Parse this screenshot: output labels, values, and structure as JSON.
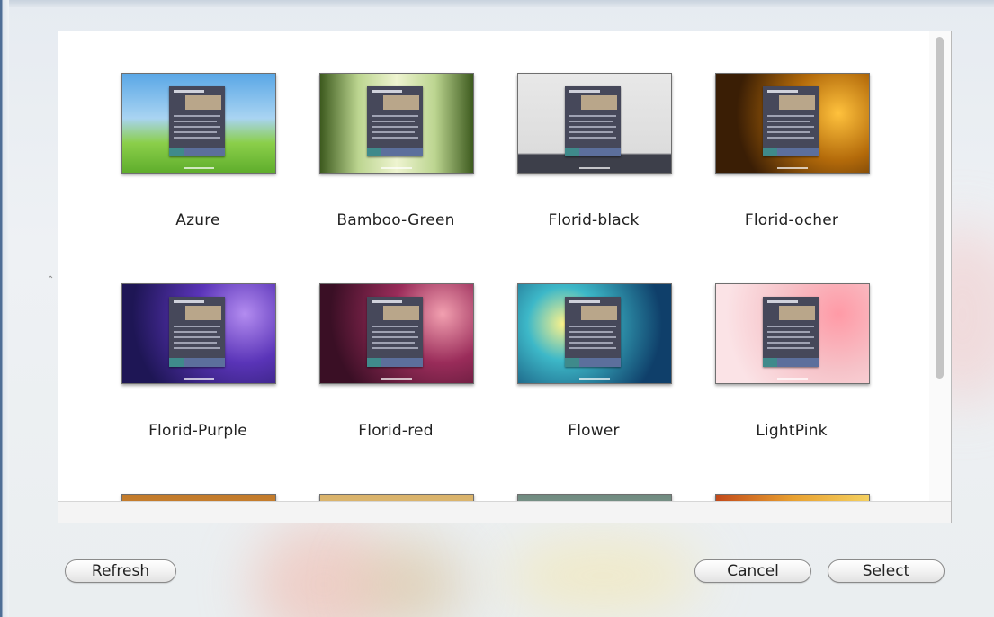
{
  "dialog": {
    "themes": [
      {
        "name": "Azure",
        "bg": "linear-gradient(180deg,#5aa7e6 0%,#a9d4f2 45%,#8bcf4a 70%,#5fae2c 100%)",
        "accent": "#e84c2a"
      },
      {
        "name": "Bamboo-Green",
        "bg": "linear-gradient(90deg,#3d5a1e 0%,#bcd590 25%,#eef4d0 50%,#bcd590 75%,#3d5a1e 100%)",
        "accent": "#4f7a1e"
      },
      {
        "name": "Florid-black",
        "bg": "linear-gradient(180deg,#e8e8e8 0%,#dcdcdc 80%,#3d3f4a 82%,#3d3f4a 100%)",
        "accent": "#3d3f4a"
      },
      {
        "name": "Florid-ocher",
        "bg": "radial-gradient(circle at 80% 40%,#ffc23d 0%,#b36a0a 35%,#3a1e05 75%)",
        "accent": "#c87a10"
      },
      {
        "name": "Florid-Purple",
        "bg": "radial-gradient(circle at 80% 30%,#b38cf0 0%,#5a34b8 35%,#1e1655 80%)",
        "accent": "#5a34b8"
      },
      {
        "name": "Florid-red",
        "bg": "radial-gradient(circle at 80% 30%,#f2a0b0 0%,#9a2c5a 35%,#3a0f25 80%)",
        "accent": "#9a2c5a"
      },
      {
        "name": "Flower",
        "bg": "radial-gradient(circle at 30% 40%,#fff38a 0%,#3db8c8 30%,#0f3f6a 80%)",
        "accent": "#1d7fa8"
      },
      {
        "name": "LightPink",
        "bg": "radial-gradient(circle at 80% 30%,#ff9aa6 0%,#f6c2c8 40%,#fbe3e6 80%)",
        "accent": "#e07a88"
      },
      {
        "name": "",
        "bg": "linear-gradient(180deg,#c27a2a 0%,#e0a24a 100%)",
        "accent": "#c27a2a"
      },
      {
        "name": "",
        "bg": "linear-gradient(180deg,#d9b26a 0%,#efd59a 100%)",
        "accent": "#d9b26a"
      },
      {
        "name": "",
        "bg": "linear-gradient(180deg,#6f8a7f 0%,#cfd6cf 100%)",
        "accent": "#6f8a7f"
      },
      {
        "name": "",
        "bg": "linear-gradient(90deg,#c24a1a 0%,#e8a030 50%,#f4d060 100%)",
        "accent": "#c24a1a"
      }
    ]
  },
  "buttons": {
    "refresh": "Refresh",
    "cancel": "Cancel",
    "select": "Select"
  }
}
